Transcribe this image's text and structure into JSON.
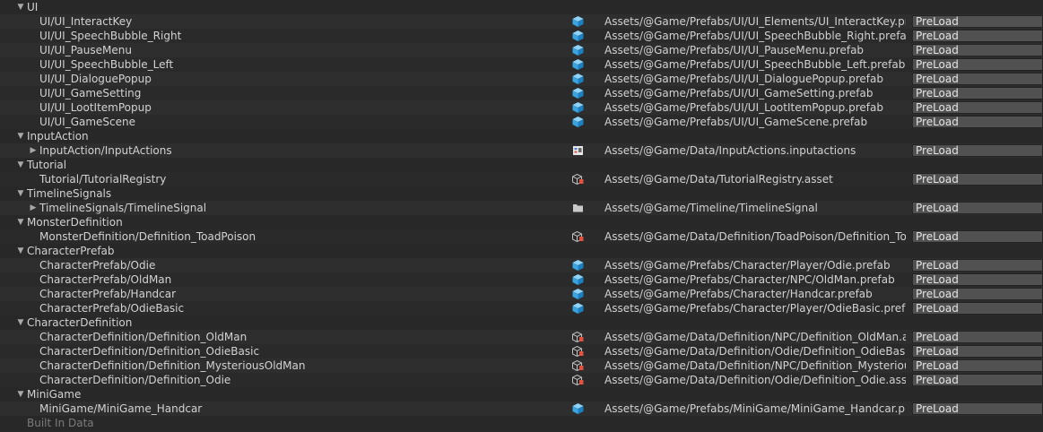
{
  "dropdown_default": "PreLoad",
  "rows": [
    {
      "kind": "group",
      "label": "UI"
    },
    {
      "kind": "entry",
      "label": "UI/UI_InteractKey",
      "icon": "prefab-icon",
      "path": "Assets/@Game/Prefabs/UI/UI_Elements/UI_InteractKey.prefab",
      "mode": "PreLoad"
    },
    {
      "kind": "entry",
      "label": "UI/UI_SpeechBubble_Right",
      "icon": "prefab-icon",
      "path": "Assets/@Game/Prefabs/UI/UI_SpeechBubble_Right.prefab",
      "mode": "PreLoad"
    },
    {
      "kind": "entry",
      "label": "UI/UI_PauseMenu",
      "icon": "prefab-icon",
      "path": "Assets/@Game/Prefabs/UI/UI_PauseMenu.prefab",
      "mode": "PreLoad"
    },
    {
      "kind": "entry",
      "label": "UI/UI_SpeechBubble_Left",
      "icon": "prefab-icon",
      "path": "Assets/@Game/Prefabs/UI/UI_SpeechBubble_Left.prefab",
      "mode": "PreLoad"
    },
    {
      "kind": "entry",
      "label": "UI/UI_DialoguePopup",
      "icon": "prefab-icon",
      "path": "Assets/@Game/Prefabs/UI/UI_DialoguePopup.prefab",
      "mode": "PreLoad"
    },
    {
      "kind": "entry",
      "label": "UI/UI_GameSetting",
      "icon": "prefab-icon",
      "path": "Assets/@Game/Prefabs/UI/UI_GameSetting.prefab",
      "mode": "PreLoad"
    },
    {
      "kind": "entry",
      "label": "UI/UI_LootItemPopup",
      "icon": "prefab-icon",
      "path": "Assets/@Game/Prefabs/UI/UI_LootItemPopup.prefab",
      "mode": "PreLoad"
    },
    {
      "kind": "entry",
      "label": "UI/UI_GameScene",
      "icon": "prefab-icon",
      "path": "Assets/@Game/Prefabs/UI/UI_GameScene.prefab",
      "mode": "PreLoad"
    },
    {
      "kind": "group",
      "label": "InputAction"
    },
    {
      "kind": "entry",
      "label": "InputAction/InputActions",
      "icon": "input-actions-icon",
      "path": "Assets/@Game/Data/InputActions.inputactions",
      "mode": "PreLoad",
      "collapsed": true
    },
    {
      "kind": "group",
      "label": "Tutorial"
    },
    {
      "kind": "entry",
      "label": "Tutorial/TutorialRegistry",
      "icon": "scriptable-object-icon",
      "path": "Assets/@Game/Data/TutorialRegistry.asset",
      "mode": "PreLoad"
    },
    {
      "kind": "group",
      "label": "TimelineSignals"
    },
    {
      "kind": "entry",
      "label": "TimelineSignals/TimelineSignal",
      "icon": "folder-icon",
      "path": "Assets/@Game/Timeline/TimelineSignal",
      "mode": "PreLoad",
      "collapsed": true
    },
    {
      "kind": "group",
      "label": "MonsterDefinition"
    },
    {
      "kind": "entry",
      "label": "MonsterDefinition/Definition_ToadPoison",
      "icon": "scriptable-object-icon",
      "path": "Assets/@Game/Data/Definition/ToadPoison/Definition_ToadPoison.asset",
      "mode": "PreLoad"
    },
    {
      "kind": "group",
      "label": "CharacterPrefab"
    },
    {
      "kind": "entry",
      "label": "CharacterPrefab/Odie",
      "icon": "prefab-icon",
      "path": "Assets/@Game/Prefabs/Character/Player/Odie.prefab",
      "mode": "PreLoad"
    },
    {
      "kind": "entry",
      "label": "CharacterPrefab/OldMan",
      "icon": "prefab-icon",
      "path": "Assets/@Game/Prefabs/Character/NPC/OldMan.prefab",
      "mode": "PreLoad"
    },
    {
      "kind": "entry",
      "label": "CharacterPrefab/Handcar",
      "icon": "prefab-icon",
      "path": "Assets/@Game/Prefabs/Character/Handcar.prefab",
      "mode": "PreLoad"
    },
    {
      "kind": "entry",
      "label": "CharacterPrefab/OdieBasic",
      "icon": "prefab-icon",
      "path": "Assets/@Game/Prefabs/Character/Player/OdieBasic.prefab",
      "mode": "PreLoad"
    },
    {
      "kind": "group",
      "label": "CharacterDefinition"
    },
    {
      "kind": "entry",
      "label": "CharacterDefinition/Definition_OldMan",
      "icon": "scriptable-object-icon",
      "path": "Assets/@Game/Data/Definition/NPC/Definition_OldMan.asset",
      "mode": "PreLoad"
    },
    {
      "kind": "entry",
      "label": "CharacterDefinition/Definition_OdieBasic",
      "icon": "scriptable-object-icon",
      "path": "Assets/@Game/Data/Definition/Odie/Definition_OdieBasic.asset",
      "mode": "PreLoad"
    },
    {
      "kind": "entry",
      "label": "CharacterDefinition/Definition_MysteriousOldMan",
      "icon": "scriptable-object-icon",
      "path": "Assets/@Game/Data/Definition/NPC/Definition_MysteriousOldMan.asset",
      "mode": "PreLoad"
    },
    {
      "kind": "entry",
      "label": "CharacterDefinition/Definition_Odie",
      "icon": "scriptable-object-icon",
      "path": "Assets/@Game/Data/Definition/Odie/Definition_Odie.asset",
      "mode": "PreLoad"
    },
    {
      "kind": "group",
      "label": "MiniGame"
    },
    {
      "kind": "entry",
      "label": "MiniGame/MiniGame_Handcar",
      "icon": "prefab-icon",
      "path": "Assets/@Game/Prefabs/MiniGame/MiniGame_Handcar.prefab",
      "mode": "PreLoad"
    },
    {
      "kind": "footer",
      "label": "Built In Data"
    }
  ]
}
